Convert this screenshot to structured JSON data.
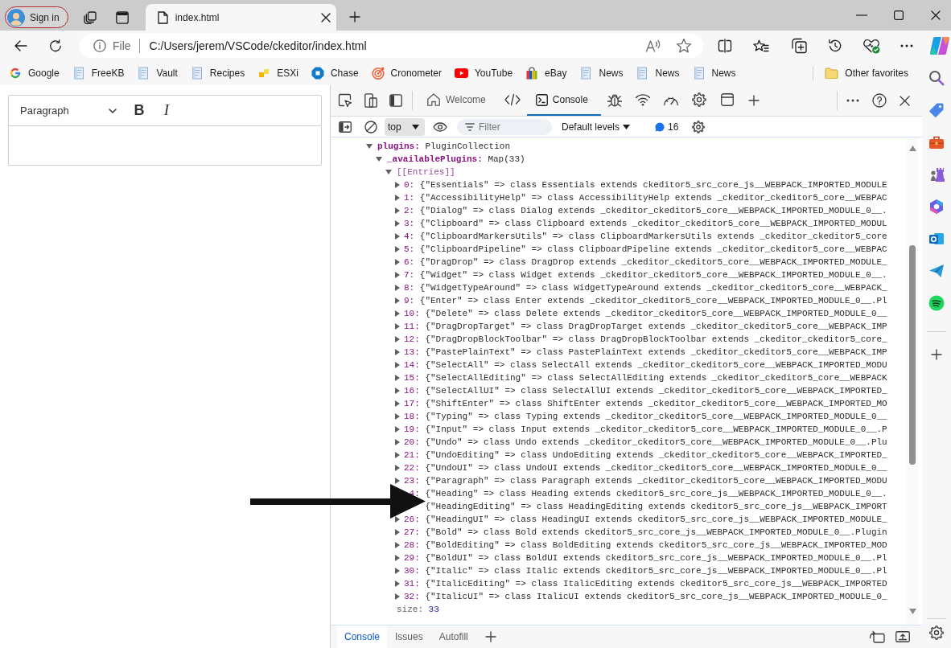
{
  "browser": {
    "profile_button": {
      "label": "Sign in"
    },
    "tabs": [
      {
        "title": "index.html",
        "selected": true
      }
    ],
    "address_bar": {
      "site_info": "File",
      "url": "C:/Users/jerem/VSCode/ckeditor/index.html"
    }
  },
  "favorites_bar": {
    "items": [
      {
        "kind": "google",
        "label": "Google"
      },
      {
        "kind": "page",
        "label": "FreeKB"
      },
      {
        "kind": "page",
        "label": "Vault"
      },
      {
        "kind": "page",
        "label": "Recipes"
      },
      {
        "kind": "squares",
        "label": "ESXi"
      },
      {
        "kind": "octagon",
        "label": "Chase"
      },
      {
        "kind": "target",
        "label": "Cronometer"
      },
      {
        "kind": "video",
        "label": "YouTube"
      },
      {
        "kind": "bag",
        "label": "eBay"
      },
      {
        "kind": "page",
        "label": "News"
      },
      {
        "kind": "page",
        "label": "News"
      },
      {
        "kind": "page",
        "label": "News"
      }
    ],
    "other_favorites": {
      "label": "Other favorites"
    }
  },
  "editor": {
    "block_format": "Paragraph",
    "buttons": [
      {
        "kind": "bold",
        "label": "B"
      },
      {
        "kind": "italic",
        "label": "I"
      }
    ]
  },
  "devtools": {
    "tabs": [
      {
        "kind": "welcome",
        "label": "Welcome",
        "selected": false
      },
      {
        "kind": "elements",
        "selected": false
      },
      {
        "kind": "console",
        "label": "Console",
        "selected": true
      },
      {
        "kind": "sources",
        "selected": false
      },
      {
        "kind": "network",
        "selected": false
      },
      {
        "kind": "performance",
        "selected": false
      },
      {
        "kind": "memory",
        "selected": false
      },
      {
        "kind": "application",
        "selected": false
      }
    ],
    "console_toolbar": {
      "context": "top",
      "filter_placeholder": "Filter",
      "levels": "Default levels",
      "message_count": "16"
    },
    "console_tree": [
      {
        "kind": "property",
        "key": "plugins:",
        "value": "PluginCollection",
        "expanded": true,
        "children": [
          {
            "kind": "property",
            "key": "_availablePlugins:",
            "value": "Map(33)",
            "expanded": true,
            "children": [
              {
                "kind": "internal",
                "key": "[[Entries]]",
                "expanded": true,
                "children": [
                  {
                    "kind": "entry",
                    "key": "0:",
                    "value": "{\"Essentials\" => class Essentials extends ckeditor5_src_core_js__WEBPACK_IMPORTED_MODULE",
                    "expanded": false
                  },
                  {
                    "kind": "entry",
                    "key": "1:",
                    "value": "{\"AccessibilityHelp\" => class AccessibilityHelp extends _ckeditor_ckeditor5_core__WEBPAC",
                    "expanded": false
                  },
                  {
                    "kind": "entry",
                    "key": "2:",
                    "value": "{\"Dialog\" => class Dialog extends _ckeditor_ckeditor5_core__WEBPACK_IMPORTED_MODULE_0__.",
                    "expanded": false
                  },
                  {
                    "kind": "entry",
                    "key": "3:",
                    "value": "{\"Clipboard\" => class Clipboard extends _ckeditor_ckeditor5_core__WEBPACK_IMPORTED_MODUL",
                    "expanded": false
                  },
                  {
                    "kind": "entry",
                    "key": "4:",
                    "value": "{\"ClipboardMarkersUtils\" => class ClipboardMarkersUtils extends _ckeditor_ckeditor5_core",
                    "expanded": false
                  },
                  {
                    "kind": "entry",
                    "key": "5:",
                    "value": "{\"ClipboardPipeline\" => class ClipboardPipeline extends _ckeditor_ckeditor5_core__WEBPAC",
                    "expanded": false
                  },
                  {
                    "kind": "entry",
                    "key": "6:",
                    "value": "{\"DragDrop\" => class DragDrop extends _ckeditor_ckeditor5_core__WEBPACK_IMPORTED_MODULE_",
                    "expanded": false
                  },
                  {
                    "kind": "entry",
                    "key": "7:",
                    "value": "{\"Widget\" => class Widget extends _ckeditor_ckeditor5_core__WEBPACK_IMPORTED_MODULE_0__.",
                    "expanded": false
                  },
                  {
                    "kind": "entry",
                    "key": "8:",
                    "value": "{\"WidgetTypeAround\" => class WidgetTypeAround extends _ckeditor_ckeditor5_core__WEBPACK_",
                    "expanded": false
                  },
                  {
                    "kind": "entry",
                    "key": "9:",
                    "value": "{\"Enter\" => class Enter extends _ckeditor_ckeditor5_core__WEBPACK_IMPORTED_MODULE_0__.Pl",
                    "expanded": false
                  },
                  {
                    "kind": "entry",
                    "key": "10:",
                    "value": "{\"Delete\" => class Delete extends _ckeditor_ckeditor5_core__WEBPACK_IMPORTED_MODULE_0__",
                    "expanded": false
                  },
                  {
                    "kind": "entry",
                    "key": "11:",
                    "value": "{\"DragDropTarget\" => class DragDropTarget extends _ckeditor_ckeditor5_core__WEBPACK_IMP",
                    "expanded": false
                  },
                  {
                    "kind": "entry",
                    "key": "12:",
                    "value": "{\"DragDropBlockToolbar\" => class DragDropBlockToolbar extends _ckeditor_ckeditor5_core_",
                    "expanded": false
                  },
                  {
                    "kind": "entry",
                    "key": "13:",
                    "value": "{\"PastePlainText\" => class PastePlainText extends _ckeditor_ckeditor5_core__WEBPACK_IMP",
                    "expanded": false
                  },
                  {
                    "kind": "entry",
                    "key": "14:",
                    "value": "{\"SelectAll\" => class SelectAll extends _ckeditor_ckeditor5_core__WEBPACK_IMPORTED_MODU",
                    "expanded": false
                  },
                  {
                    "kind": "entry",
                    "key": "15:",
                    "value": "{\"SelectAllEditing\" => class SelectAllEditing extends _ckeditor_ckeditor5_core__WEBPACK",
                    "expanded": false
                  },
                  {
                    "kind": "entry",
                    "key": "16:",
                    "value": "{\"SelectAllUI\" => class SelectAllUI extends _ckeditor_ckeditor5_core__WEBPACK_IMPORTED_",
                    "expanded": false
                  },
                  {
                    "kind": "entry",
                    "key": "17:",
                    "value": "{\"ShiftEnter\" => class ShiftEnter extends _ckeditor_ckeditor5_core__WEBPACK_IMPORTED_MO",
                    "expanded": false
                  },
                  {
                    "kind": "entry",
                    "key": "18:",
                    "value": "{\"Typing\" => class Typing extends _ckeditor_ckeditor5_core__WEBPACK_IMPORTED_MODULE_0__",
                    "expanded": false
                  },
                  {
                    "kind": "entry",
                    "key": "19:",
                    "value": "{\"Input\" => class Input extends _ckeditor_ckeditor5_core__WEBPACK_IMPORTED_MODULE_0__.P",
                    "expanded": false
                  },
                  {
                    "kind": "entry",
                    "key": "20:",
                    "value": "{\"Undo\" => class Undo extends _ckeditor_ckeditor5_core__WEBPACK_IMPORTED_MODULE_0__.Plu",
                    "expanded": false
                  },
                  {
                    "kind": "entry",
                    "key": "21:",
                    "value": "{\"UndoEditing\" => class UndoEditing extends _ckeditor_ckeditor5_core__WEBPACK_IMPORTED_",
                    "expanded": false
                  },
                  {
                    "kind": "entry",
                    "key": "22:",
                    "value": "{\"UndoUI\" => class UndoUI extends _ckeditor_ckeditor5_core__WEBPACK_IMPORTED_MODULE_0__",
                    "expanded": false
                  },
                  {
                    "kind": "entry",
                    "key": "23:",
                    "value": "{\"Paragraph\" => class Paragraph extends _ckeditor_ckeditor5_core__WEBPACK_IMPORTED_MODU",
                    "expanded": false
                  },
                  {
                    "kind": "entry",
                    "key": "4:",
                    "value": "{\"Heading\" => class Heading extends ckeditor5_src_core_js__WEBPACK_IMPORTED_MODULE_0__."
                  },
                  {
                    "kind": "entry",
                    "value": "{\"HeadingEditing\" => class HeadingEditing extends ckeditor5_src_core_js__WEBPACK_IMPORT"
                  },
                  {
                    "kind": "entry",
                    "key": "26:",
                    "value": "{\"HeadingUI\" => class HeadingUI extends ckeditor5_src_core_js__WEBPACK_IMPORTED_MODULE_",
                    "expanded": false
                  },
                  {
                    "kind": "entry",
                    "key": "27:",
                    "value": "{\"Bold\" => class Bold extends ckeditor5_src_core_js__WEBPACK_IMPORTED_MODULE_0__.Plugin",
                    "expanded": false
                  },
                  {
                    "kind": "entry",
                    "key": "28:",
                    "value": "{\"BoldEditing\" => class BoldEditing extends ckeditor5_src_core_js__WEBPACK_IMPORTED_MOD",
                    "expanded": false
                  },
                  {
                    "kind": "entry",
                    "key": "29:",
                    "value": "{\"BoldUI\" => class BoldUI extends ckeditor5_src_core_js__WEBPACK_IMPORTED_MODULE_0__.Pl",
                    "expanded": false
                  },
                  {
                    "kind": "entry",
                    "key": "30:",
                    "value": "{\"Italic\" => class Italic extends ckeditor5_src_core_js__WEBPACK_IMPORTED_MODULE_0__.Pl",
                    "expanded": false
                  },
                  {
                    "kind": "entry",
                    "key": "31:",
                    "value": "{\"ItalicEditing\" => class ItalicEditing extends ckeditor5_src_core_js__WEBPACK_IMPORTED",
                    "expanded": false
                  },
                  {
                    "kind": "entry",
                    "key": "32:",
                    "value": "{\"ItalicUI\" => class ItalicUI extends ckeditor5_src_core_js__WEBPACK_IMPORTED_MODULE_0_",
                    "expanded": false
                  }
                ]
              },
              {
                "kind": "meta",
                "key": "size:",
                "value": "33"
              }
            ]
          }
        ]
      }
    ],
    "drawer_tabs": [
      {
        "label": "Console",
        "selected": true
      },
      {
        "label": "Issues",
        "selected": false
      },
      {
        "label": "Autofill",
        "selected": false
      }
    ]
  }
}
